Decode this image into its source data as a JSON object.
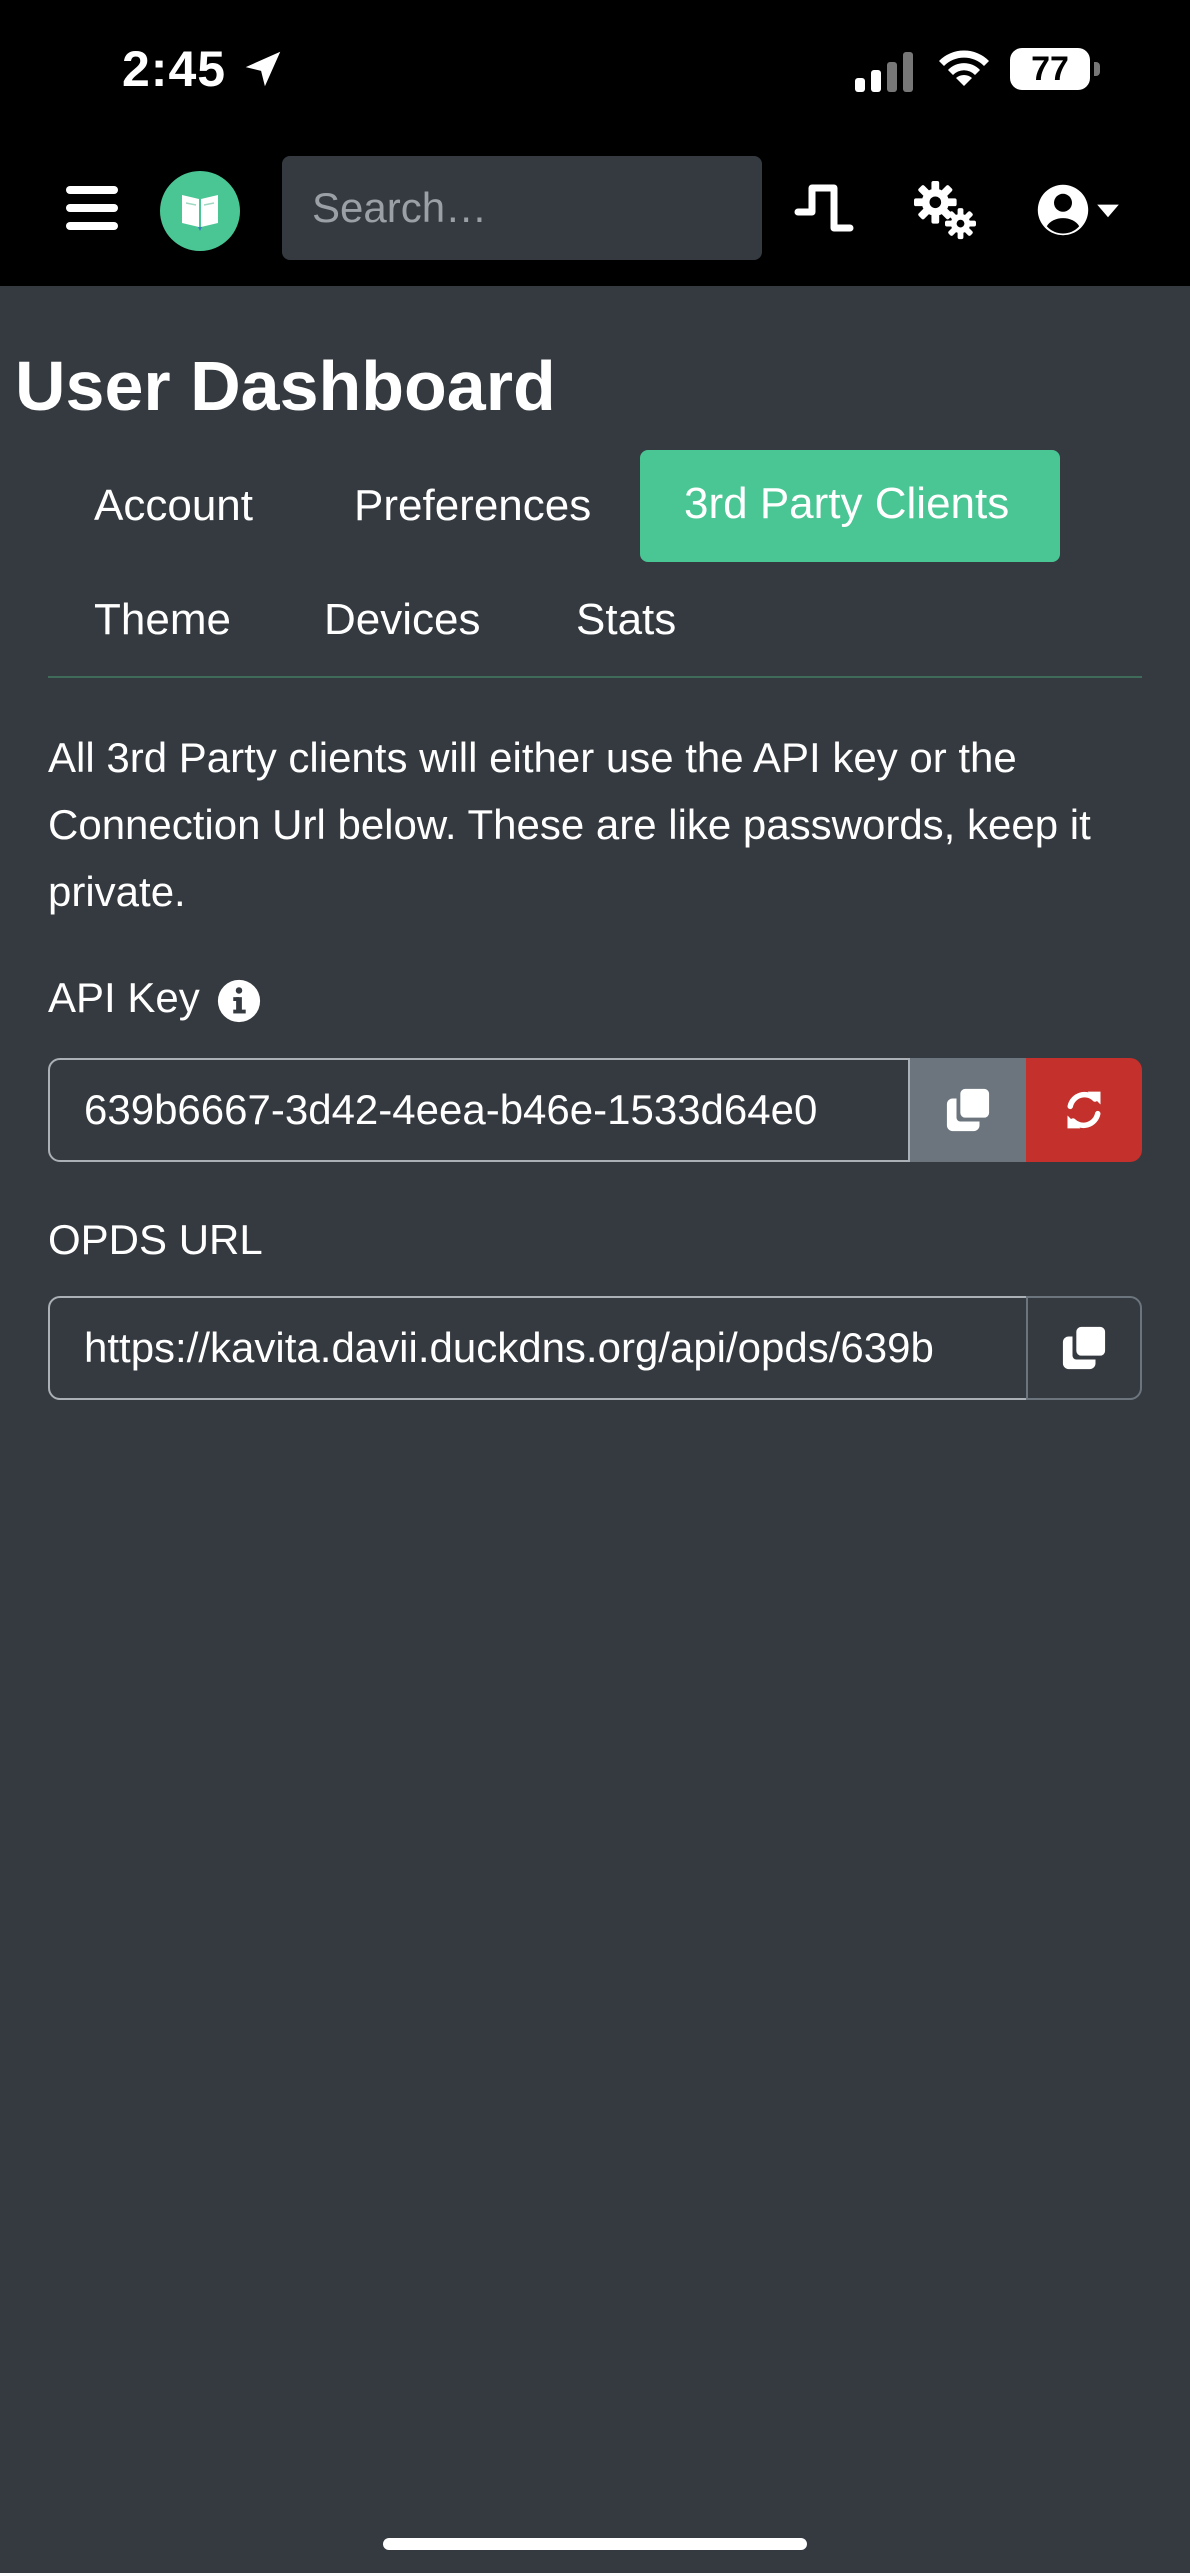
{
  "status_bar": {
    "time": "2:45",
    "battery": "77"
  },
  "navbar": {
    "search_placeholder": "Search…",
    "icons": [
      "menu-icon",
      "book-logo",
      "activity-icon",
      "settings-icon",
      "user-icon"
    ],
    "logo_color": "#4ac694"
  },
  "page": {
    "title": "User Dashboard",
    "tabs": [
      {
        "label": "Account",
        "active": false
      },
      {
        "label": "Preferences",
        "active": false
      },
      {
        "label": "3rd Party Clients",
        "active": true
      },
      {
        "label": "Theme",
        "active": false
      },
      {
        "label": "Devices",
        "active": false
      },
      {
        "label": "Stats",
        "active": false
      }
    ],
    "description": "All 3rd Party clients will either use the API key or the Connection Url below. These are like passwords, keep it private.",
    "api_key": {
      "label": "API Key",
      "value": "639b6667-3d42-4eea-b46e-1533d64e0"
    },
    "opds_url": {
      "label": "OPDS URL",
      "value": "https://kavita.davii.duckdns.org/api/opds/639b"
    }
  },
  "colors": {
    "accent": "#4ac694",
    "danger": "#c4302b",
    "secondary": "#6c757d",
    "background": "#343a40"
  }
}
